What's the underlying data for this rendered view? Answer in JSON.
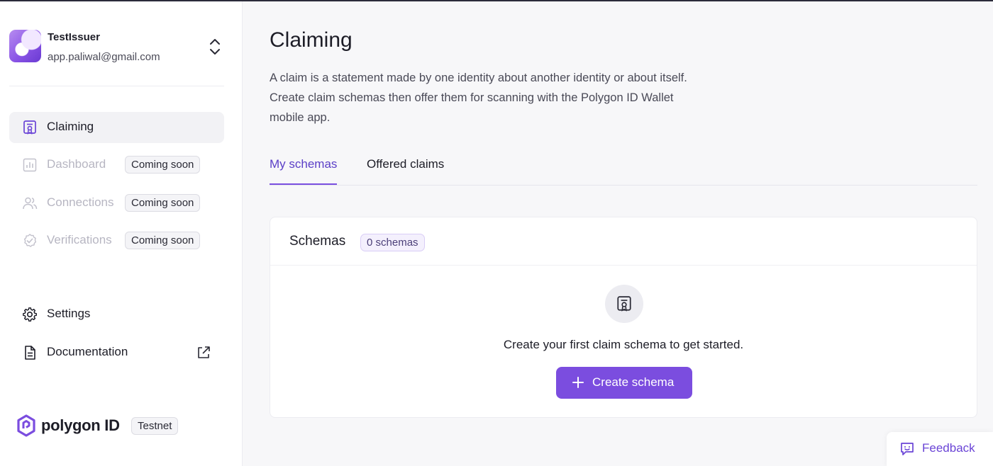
{
  "account": {
    "name": "TestIssuer",
    "email": "app.paliwal@gmail.com"
  },
  "sidebar": {
    "items": [
      {
        "label": "Claiming",
        "icon": "certificate-icon",
        "state": "active"
      },
      {
        "label": "Dashboard",
        "icon": "bar-chart-icon",
        "state": "disabled",
        "badge": "Coming soon"
      },
      {
        "label": "Connections",
        "icon": "users-icon",
        "state": "disabled",
        "badge": "Coming soon"
      },
      {
        "label": "Verifications",
        "icon": "check-circle-icon",
        "state": "disabled",
        "badge": "Coming soon"
      }
    ],
    "settings_label": "Settings",
    "documentation_label": "Documentation"
  },
  "brand": {
    "name": "polygon ID",
    "network_badge": "Testnet"
  },
  "page": {
    "title": "Claiming",
    "description_lines": [
      "A claim is a statement made by one identity about another identity or about itself.",
      "Create claim schemas then offer them for scanning with the Polygon ID Wallet",
      "mobile app."
    ]
  },
  "tabs": [
    {
      "label": "My schemas",
      "active": true
    },
    {
      "label": "Offered claims",
      "active": false
    }
  ],
  "schemas_card": {
    "title": "Schemas",
    "count_badge": "0 schemas",
    "empty_text": "Create your first claim schema to get started.",
    "create_button_label": "Create schema"
  },
  "feedback": {
    "label": "Feedback"
  },
  "colors": {
    "accent": "#7b4ddf",
    "active_tab": "#5b3fc7",
    "disabled_text": "#b7b6c2",
    "background": "#f7f7f9"
  }
}
